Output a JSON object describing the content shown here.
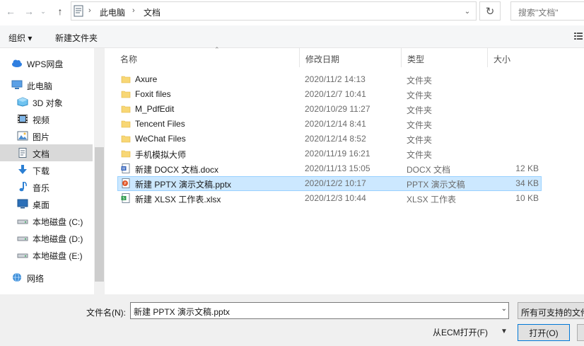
{
  "address": {
    "breadcrumb": [
      "此电脑",
      "文档"
    ],
    "search_placeholder": "搜索\"文档\""
  },
  "toolbar": {
    "organize_label": "组织 ▾",
    "new_folder_label": "新建文件夹"
  },
  "sidebar": {
    "items": [
      {
        "label": "WPS网盘",
        "icon": "cloud-icon"
      },
      {
        "label": "此电脑",
        "icon": "computer-icon"
      },
      {
        "label": "3D 对象",
        "icon": "3d-objects-icon"
      },
      {
        "label": "视频",
        "icon": "video-icon"
      },
      {
        "label": "图片",
        "icon": "pictures-icon"
      },
      {
        "label": "文档",
        "icon": "documents-icon"
      },
      {
        "label": "下载",
        "icon": "download-icon"
      },
      {
        "label": "音乐",
        "icon": "music-icon"
      },
      {
        "label": "桌面",
        "icon": "desktop-icon"
      },
      {
        "label": "本地磁盘 (C:)",
        "icon": "drive-icon"
      },
      {
        "label": "本地磁盘 (D:)",
        "icon": "drive-icon"
      },
      {
        "label": "本地磁盘 (E:)",
        "icon": "drive-icon"
      },
      {
        "label": "网络",
        "icon": "network-icon"
      }
    ],
    "selected_index": 5
  },
  "columns": {
    "name": "名称",
    "modified": "修改日期",
    "type": "类型",
    "size": "大小"
  },
  "files": [
    {
      "name": "Axure",
      "modified": "2020/11/2 14:13",
      "type": "文件夹",
      "size": "",
      "icon": "folder-icon"
    },
    {
      "name": "Foxit files",
      "modified": "2020/12/7 10:41",
      "type": "文件夹",
      "size": "",
      "icon": "folder-icon"
    },
    {
      "name": "M_PdfEdit",
      "modified": "2020/10/29 11:27",
      "type": "文件夹",
      "size": "",
      "icon": "folder-icon"
    },
    {
      "name": "Tencent Files",
      "modified": "2020/12/14 8:41",
      "type": "文件夹",
      "size": "",
      "icon": "folder-icon"
    },
    {
      "name": "WeChat Files",
      "modified": "2020/12/14 8:52",
      "type": "文件夹",
      "size": "",
      "icon": "folder-icon"
    },
    {
      "name": "手机模拟大师",
      "modified": "2020/11/19 16:21",
      "type": "文件夹",
      "size": "",
      "icon": "folder-icon"
    },
    {
      "name": "新建 DOCX 文档.docx",
      "modified": "2020/11/13 15:05",
      "type": "DOCX 文档",
      "size": "12 KB",
      "icon": "docx-icon"
    },
    {
      "name": "新建 PPTX 演示文稿.pptx",
      "modified": "2020/12/2 10:17",
      "type": "PPTX 演示文稿",
      "size": "34 KB",
      "icon": "pptx-icon"
    },
    {
      "name": "新建 XLSX 工作表.xlsx",
      "modified": "2020/12/3 10:44",
      "type": "XLSX 工作表",
      "size": "10 KB",
      "icon": "xlsx-icon"
    }
  ],
  "selected_file_index": 7,
  "bottom": {
    "filename_label": "文件名(N):",
    "filename_value": "新建 PPTX 演示文稿.pptx",
    "filetype_label": "所有可支持的文件",
    "ecm_open_label": "从ECM打开(F)",
    "open_label": "打开(O)"
  },
  "colors": {
    "selection_bg": "#cce8ff",
    "selection_border": "#99d1ff",
    "folder": "#f8d775",
    "accent": "#0078d7"
  }
}
